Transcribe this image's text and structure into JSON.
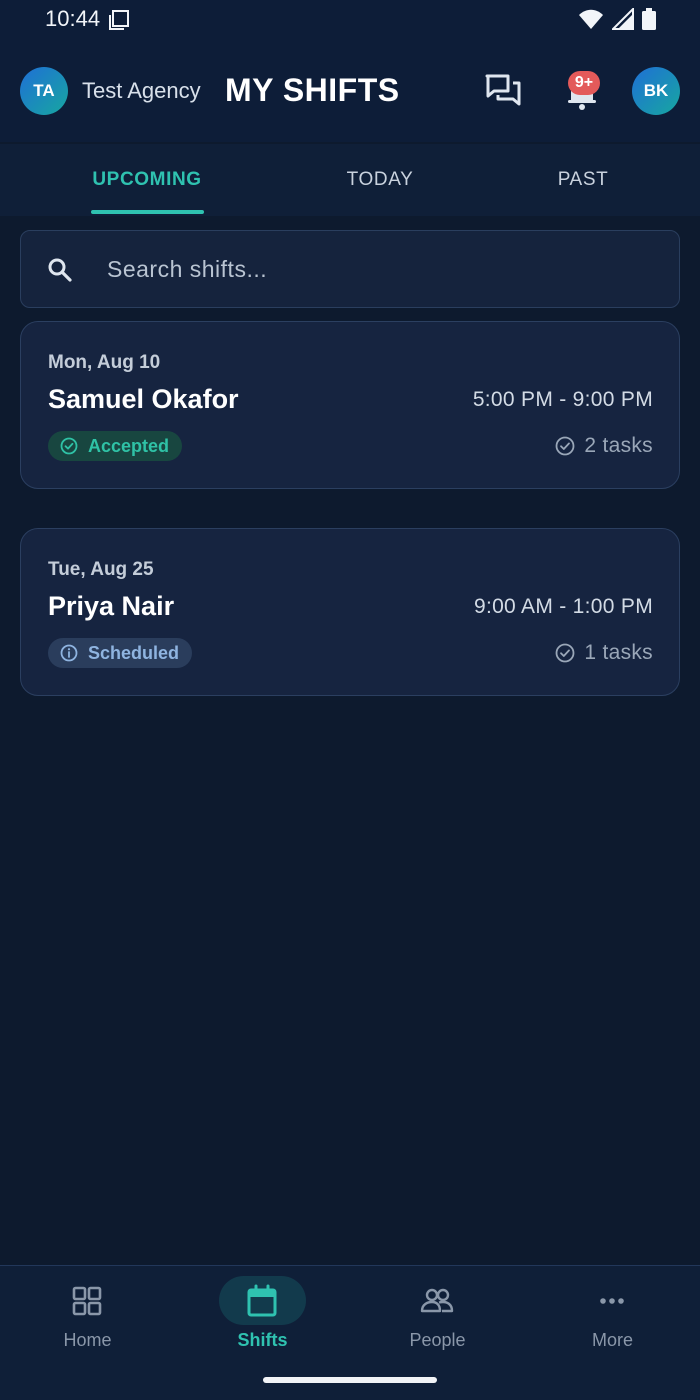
{
  "status_bar": {
    "time": "10:44"
  },
  "header": {
    "agency_initials": "TA",
    "agency_name": "Test Agency",
    "title": "MY SHIFTS",
    "notification_badge": "9+",
    "user_initials": "BK"
  },
  "tabs": [
    {
      "label": "UPCOMING",
      "active": true
    },
    {
      "label": "TODAY",
      "active": false
    },
    {
      "label": "PAST",
      "active": false
    }
  ],
  "search": {
    "placeholder": "Search shifts...",
    "value": ""
  },
  "shifts": [
    {
      "date": "Mon, Aug 10",
      "name": "Samuel Okafor",
      "time": "5:00 PM - 9:00 PM",
      "status": "Accepted",
      "tasks": "2 tasks"
    },
    {
      "date": "Tue, Aug 25",
      "name": "Priya Nair",
      "time": "9:00 AM - 1:00 PM",
      "status": "Scheduled",
      "tasks": "1 tasks"
    }
  ],
  "bottom_nav": [
    {
      "label": "Home",
      "icon": "grid-icon",
      "active": false
    },
    {
      "label": "Shifts",
      "icon": "calendar-icon",
      "active": true
    },
    {
      "label": "People",
      "icon": "people-icon",
      "active": false
    },
    {
      "label": "More",
      "icon": "more-dots-icon",
      "active": false
    }
  ],
  "colors": {
    "background": "#0d1a2e",
    "accent": "#2fc2b0",
    "badge_red": "#e35a5a",
    "card": "#162440"
  }
}
